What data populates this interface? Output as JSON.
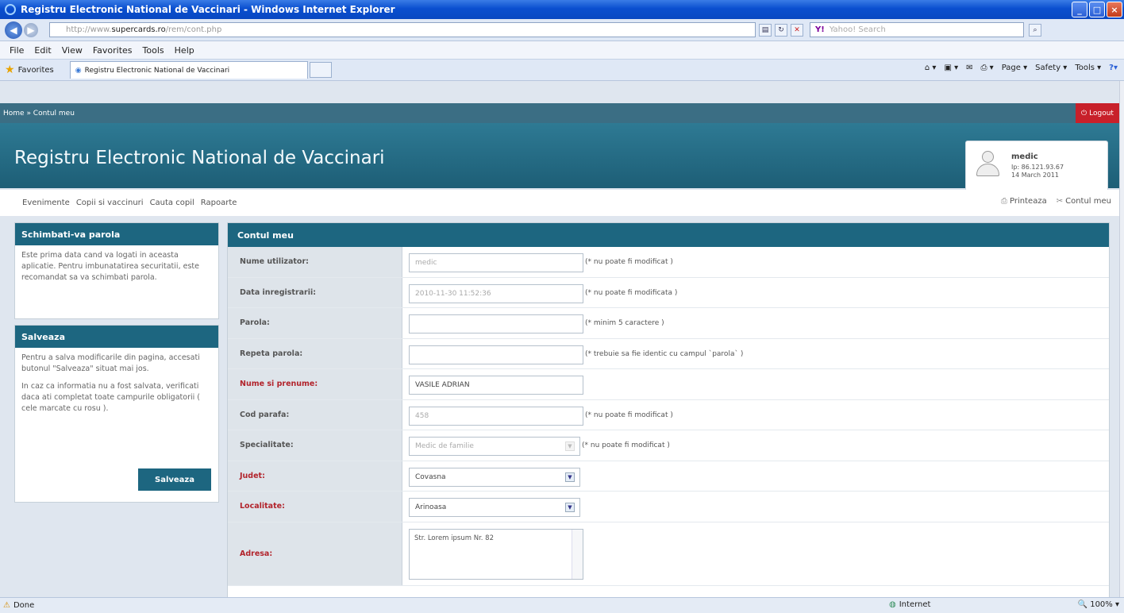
{
  "window": {
    "title": "Registru Electronic National de Vaccinari - Windows Internet Explorer",
    "controls": [
      "_",
      "□",
      "×"
    ]
  },
  "address": {
    "url_prefix": "http://www.",
    "url_domain": "supercards.ro",
    "url_suffix": "/rem/cont.php",
    "search_placeholder": "Yahoo! Search"
  },
  "menu": [
    "File",
    "Edit",
    "View",
    "Favorites",
    "Tools",
    "Help"
  ],
  "favorites": {
    "label": "Favorites",
    "tab_title": "Registru Electronic National de Vaccinari",
    "commands": [
      "Page",
      "Safety",
      "Tools"
    ]
  },
  "site": {
    "breadcrumb": "Home » Contul meu",
    "logout": "Logout",
    "title": "Registru Electronic National de Vaccinari",
    "user": {
      "name": "medic",
      "ip": "Ip: 86.121.93.67",
      "date": "14 March 2011"
    },
    "nav": [
      "Evenimente",
      "Copii si vaccinuri",
      "Cauta copil",
      "Rapoarte"
    ],
    "nav_right": [
      "Printeaza",
      "Contul meu"
    ]
  },
  "panel_password": {
    "heading": "Schimbati-va parola",
    "text": "Este prima data cand va logati in aceasta aplicatie. Pentru imbunatatirea securitatii, este recomandat sa va schimbati parola."
  },
  "panel_save": {
    "heading": "Salveaza",
    "text1": "Pentru a salva modificarile din pagina, accesati butonul \"Salveaza\" situat mai jos.",
    "text2": "In caz ca informatia nu a fost salvata, verificati daca ati completat toate campurile obligatorii ( cele marcate cu rosu ).",
    "button": "Salveaza"
  },
  "form": {
    "heading": "Contul meu",
    "username": {
      "label": "Nume utilizator:",
      "value": "medic",
      "note": "(* nu poate fi modificat )"
    },
    "regdate": {
      "label": "Data inregistrarii:",
      "value": "2010-11-30 11:52:36",
      "note": "(* nu poate fi modificata )"
    },
    "password": {
      "label": "Parola:",
      "value": "",
      "note": "(* minim 5 caractere )"
    },
    "repeat": {
      "label": "Repeta parola:",
      "value": "",
      "note": "(* trebuie sa fie identic cu campul `parola` )"
    },
    "fullname": {
      "label": "Nume si prenume:",
      "value": "VASILE ADRIAN"
    },
    "code": {
      "label": "Cod parafa:",
      "value": "458",
      "note": "(* nu poate fi modificat )"
    },
    "specialty": {
      "label": "Specialitate:",
      "value": "Medic de familie",
      "note": "(* nu poate fi modificat )"
    },
    "county": {
      "label": "Judet:",
      "value": "Covasna"
    },
    "city": {
      "label": "Localitate:",
      "value": "Arinoasa"
    },
    "address": {
      "label": "Adresa:",
      "value": "Str. Lorem ipsum Nr. 82"
    }
  },
  "statusbar": {
    "left": "Done",
    "zone": "Internet",
    "zoom": "100%"
  }
}
